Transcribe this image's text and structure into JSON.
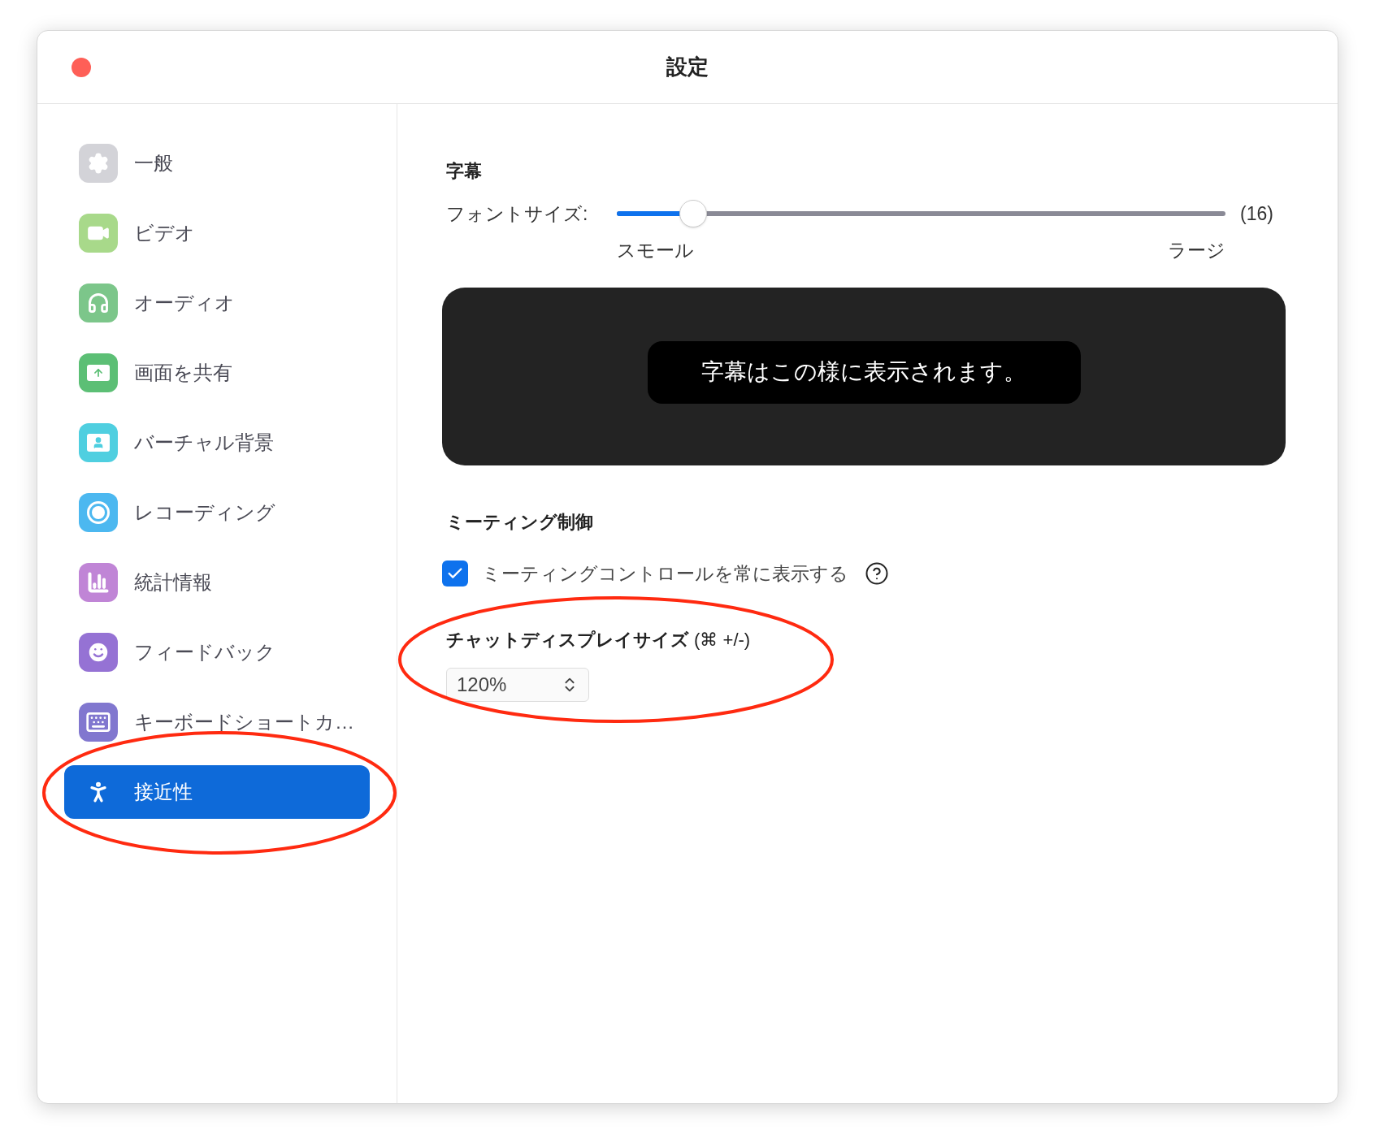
{
  "window": {
    "title": "設定"
  },
  "sidebar": {
    "items": [
      {
        "label": "一般",
        "kind": "general",
        "selected": false
      },
      {
        "label": "ビデオ",
        "kind": "video",
        "selected": false
      },
      {
        "label": "オーディオ",
        "kind": "audio",
        "selected": false
      },
      {
        "label": "画面を共有",
        "kind": "share",
        "selected": false
      },
      {
        "label": "バーチャル背景",
        "kind": "background",
        "selected": false
      },
      {
        "label": "レコーディング",
        "kind": "recording",
        "selected": false
      },
      {
        "label": "統計情報",
        "kind": "statistics",
        "selected": false
      },
      {
        "label": "フィードバック",
        "kind": "feedback",
        "selected": false
      },
      {
        "label": "キーボードショートカ…",
        "kind": "keyboard",
        "selected": false
      },
      {
        "label": "接近性",
        "kind": "accessibility",
        "selected": true
      }
    ]
  },
  "captions": {
    "heading": "字幕",
    "font_size_label": "フォントサイズ:",
    "slider": {
      "level": 0.126,
      "reading": "(16)",
      "min_label": "スモール",
      "max_label": "ラージ"
    },
    "preview_text": "字幕はこの様に表示されます。"
  },
  "meeting_controls": {
    "heading": "ミーティング制御",
    "checkbox": {
      "label": "ミーティングコントロールを常に表示する",
      "checked": true
    }
  },
  "chat_display": {
    "heading": "**チャットディスプレイサイズ** (⌘ +/-)",
    "value": "120%"
  }
}
